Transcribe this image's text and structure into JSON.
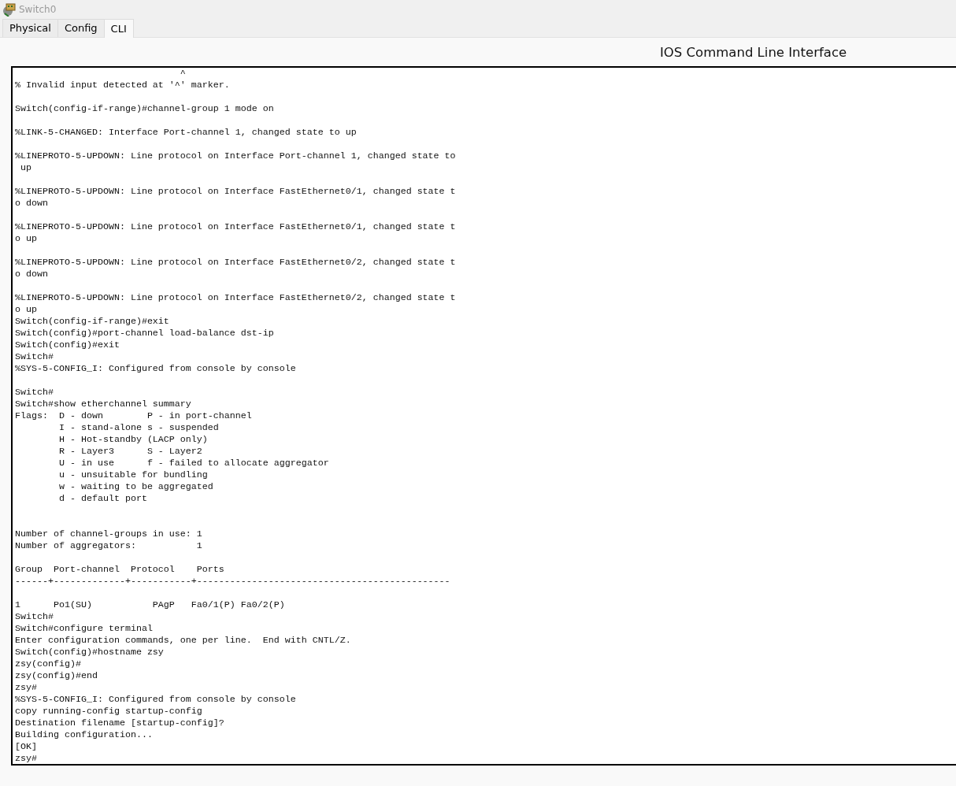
{
  "window": {
    "title": "Switch0"
  },
  "tabs": [
    {
      "label": "Physical",
      "selected": false
    },
    {
      "label": "Config",
      "selected": false
    },
    {
      "label": "CLI",
      "selected": true
    }
  ],
  "cli": {
    "heading": "IOS Command Line Interface",
    "output": "                              ^\n% Invalid input detected at '^' marker.\n\nSwitch(config-if-range)#channel-group 1 mode on\n\n%LINK-5-CHANGED: Interface Port-channel 1, changed state to up\n\n%LINEPROTO-5-UPDOWN: Line protocol on Interface Port-channel 1, changed state to\n up\n\n%LINEPROTO-5-UPDOWN: Line protocol on Interface FastEthernet0/1, changed state t\no down\n\n%LINEPROTO-5-UPDOWN: Line protocol on Interface FastEthernet0/1, changed state t\no up\n\n%LINEPROTO-5-UPDOWN: Line protocol on Interface FastEthernet0/2, changed state t\no down\n\n%LINEPROTO-5-UPDOWN: Line protocol on Interface FastEthernet0/2, changed state t\no up\nSwitch(config-if-range)#exit\nSwitch(config)#port-channel load-balance dst-ip\nSwitch(config)#exit\nSwitch#\n%SYS-5-CONFIG_I: Configured from console by console\n\nSwitch#\nSwitch#show etherchannel summary\nFlags:  D - down        P - in port-channel\n        I - stand-alone s - suspended\n        H - Hot-standby (LACP only)\n        R - Layer3      S - Layer2\n        U - in use      f - failed to allocate aggregator\n        u - unsuitable for bundling\n        w - waiting to be aggregated\n        d - default port\n\n\nNumber of channel-groups in use: 1\nNumber of aggregators:           1\n\nGroup  Port-channel  Protocol    Ports\n------+-------------+-----------+----------------------------------------------\n\n1      Po1(SU)           PAgP   Fa0/1(P) Fa0/2(P)\nSwitch#\nSwitch#configure terminal\nEnter configuration commands, one per line.  End with CNTL/Z.\nSwitch(config)#hostname zsy\nzsy(config)#\nzsy(config)#end\nzsy#\n%SYS-5-CONFIG_I: Configured from console by console\ncopy running-config startup-config\nDestination filename [startup-config]?\nBuilding configuration...\n[OK]\nzsy#"
  }
}
